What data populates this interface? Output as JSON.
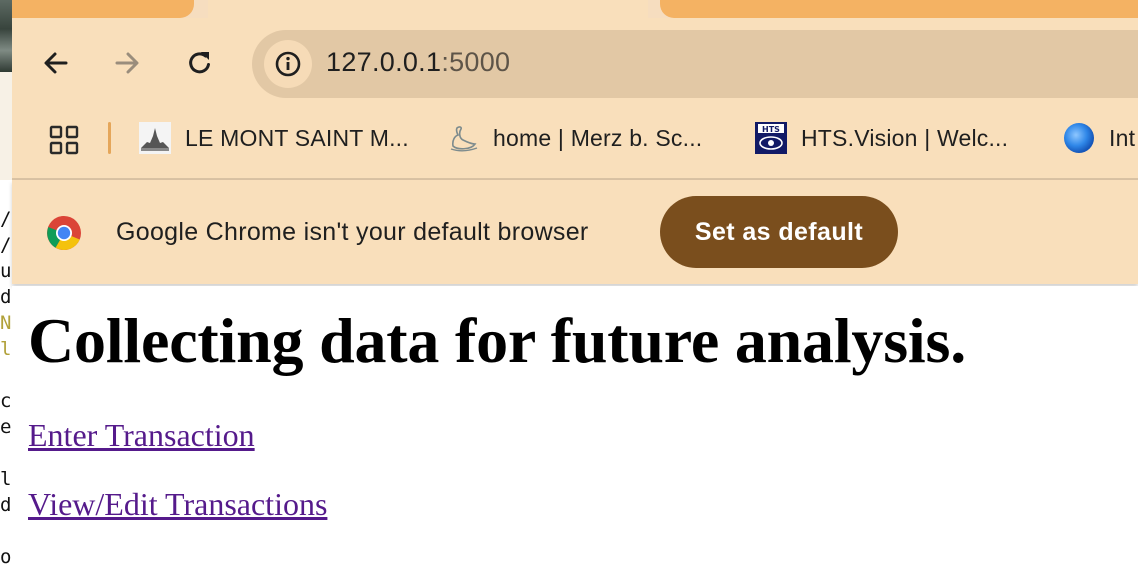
{
  "browser": {
    "url_host": "127.0.0.1",
    "url_port": ":5000",
    "nav": {
      "back_icon": "arrow-left-icon",
      "forward_icon": "arrow-right-icon",
      "reload_icon": "reload-icon",
      "site_info_icon": "info-icon"
    },
    "bookmarks": [
      {
        "label": "LE MONT SAINT M...",
        "icon": "castle-favicon"
      },
      {
        "label": "home | Merz b. Sc...",
        "icon": "swan-favicon"
      },
      {
        "label": "HTS.Vision | Welc...",
        "icon": "hts-favicon"
      },
      {
        "label": "Int",
        "icon": "globe-favicon"
      }
    ],
    "infobar": {
      "message": "Google Chrome isn't your default browser",
      "button_label": "Set as default"
    },
    "colors": {
      "toolbar": "#f9dfbb",
      "tab": "#f4b263",
      "omnibox": "#e2c8a5",
      "button": "#7a4e1d",
      "link": "#551a8b"
    }
  },
  "page": {
    "heading": "Collecting data for future analysis.",
    "links": [
      {
        "label": "Enter Transaction"
      },
      {
        "label": "View/Edit Transactions"
      }
    ]
  },
  "background_terminal": {
    "lines": [
      "/",
      "/",
      "u",
      "d",
      "N",
      "l",
      "",
      "c",
      "e",
      "",
      "l",
      "d",
      "",
      "o"
    ]
  }
}
